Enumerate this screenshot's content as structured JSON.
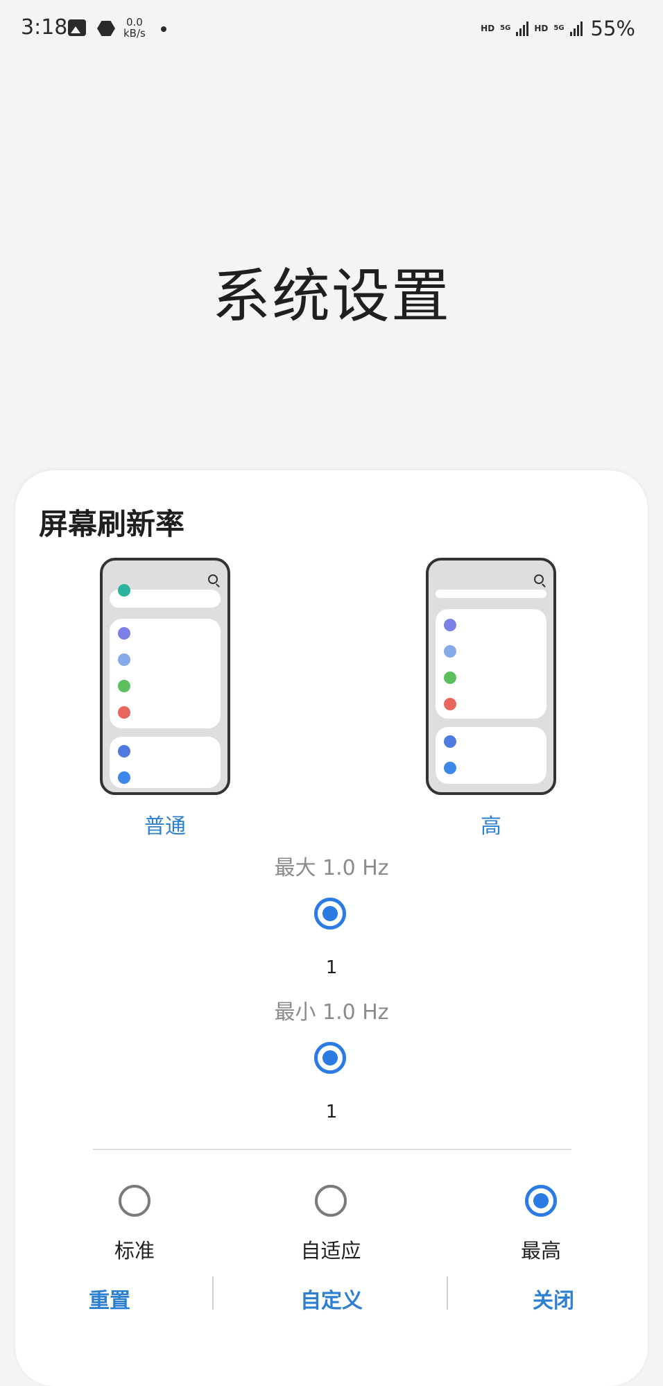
{
  "status_bar": {
    "time": "3:18",
    "speed_top": "0.0",
    "speed_unit": "kB/s",
    "hd1": "HD",
    "net1": "5G",
    "hd2": "HD",
    "net2": "5G",
    "battery": "55%"
  },
  "page": {
    "title": "系统设置"
  },
  "sheet": {
    "title": "屏幕刷新率",
    "modes": [
      {
        "label": "普通"
      },
      {
        "label": "高"
      }
    ],
    "max_label": "最大 1.0 Hz",
    "max_value": "1",
    "min_label": "最小 1.0 Hz",
    "min_value": "1",
    "options": [
      {
        "label": "标准",
        "selected": false
      },
      {
        "label": "自适应",
        "selected": false
      },
      {
        "label": "最高",
        "selected": true
      }
    ],
    "actions": {
      "reset": "重置",
      "custom": "自定义",
      "close": "关闭"
    }
  },
  "colors": {
    "accent": "#2c7be5",
    "dot_teal": "#2bb39b",
    "dot_purple": "#7b7fe6",
    "dot_lightblue": "#86a9ea",
    "dot_green": "#5cbf5f",
    "dot_red": "#e8675c",
    "dot_blue": "#4f7ae0",
    "dot_blue2": "#3d86ea"
  }
}
